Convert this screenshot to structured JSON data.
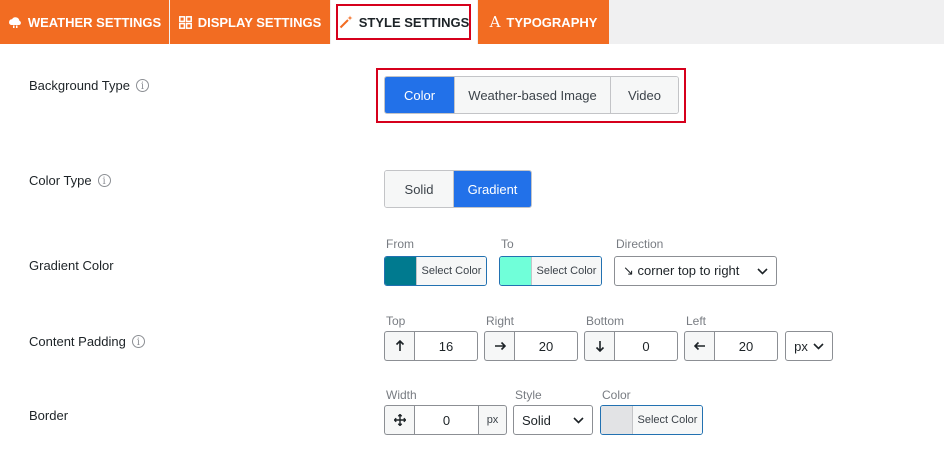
{
  "tabs": [
    {
      "label": "WEATHER SETTINGS",
      "icon": "weather-icon"
    },
    {
      "label": "DISPLAY SETTINGS",
      "icon": "grid-icon"
    },
    {
      "label": "STYLE SETTINGS",
      "icon": "magic-wand-icon",
      "active": true
    },
    {
      "label": "TYPOGRAPHY",
      "icon": "typography-icon"
    }
  ],
  "background_type": {
    "label": "Background Type",
    "options": [
      "Color",
      "Weather-based Image",
      "Video"
    ],
    "selected": "Color"
  },
  "color_type": {
    "label": "Color Type",
    "options": [
      "Solid",
      "Gradient"
    ],
    "selected": "Gradient"
  },
  "gradient_color": {
    "label": "Gradient Color",
    "from_label": "From",
    "to_label": "To",
    "direction_label": "Direction",
    "select_color_text": "Select Color",
    "from_color": "#007a8f",
    "to_color": "#70ffd9",
    "direction_value": "↘ corner top to right"
  },
  "content_padding": {
    "label": "Content Padding",
    "top_label": "Top",
    "top_value": "16",
    "right_label": "Right",
    "right_value": "20",
    "bottom_label": "Bottom",
    "bottom_value": "0",
    "left_label": "Left",
    "left_value": "20",
    "unit": "px"
  },
  "border": {
    "label": "Border",
    "width_label": "Width",
    "width_value": "0",
    "width_unit": "px",
    "style_label": "Style",
    "style_value": "Solid",
    "color_label": "Color",
    "color_swatch": "#e2e3e5",
    "select_color_text": "Select Color"
  },
  "colors": {
    "accent": "#f26c22",
    "selected": "#2271e9",
    "highlight": "#d6001c"
  }
}
